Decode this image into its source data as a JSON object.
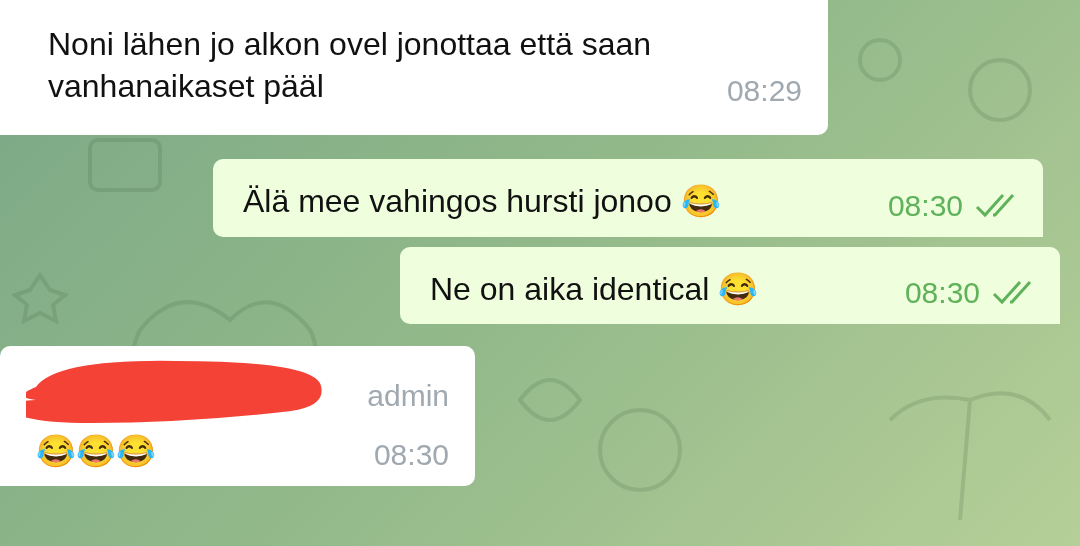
{
  "messages": [
    {
      "kind": "incoming",
      "text": "Noni lähen jo alkon ovel jonottaa että saan vanhanaikaset pääl",
      "time": "08:29"
    },
    {
      "kind": "outgoing",
      "text": "Älä mee vahingos hursti jonoo 😂",
      "time": "08:30",
      "read": true
    },
    {
      "kind": "outgoing",
      "text": "Ne on aika identical 😂",
      "time": "08:30",
      "read": true
    },
    {
      "kind": "incoming",
      "redacted": true,
      "role": "admin",
      "text": "😂😂😂",
      "time": "08:30"
    }
  ]
}
